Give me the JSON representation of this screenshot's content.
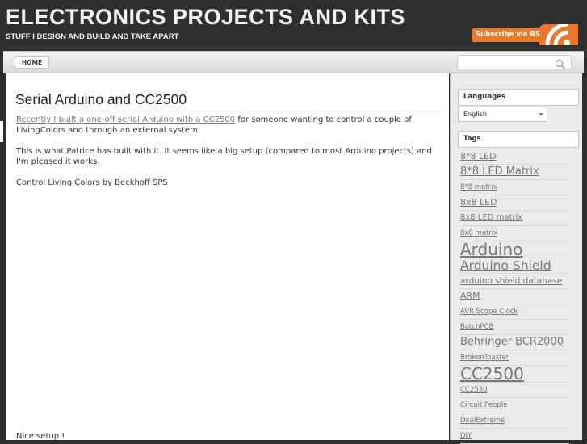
{
  "header": {
    "title": "ELECTRONICS PROJECTS AND KITS",
    "tagline": "STUFF I DESIGN AND BUILD AND TAKE APART",
    "rss_label": "Subscribe via RSS"
  },
  "nav": {
    "home_label": "HOME",
    "search_placeholder": ""
  },
  "post": {
    "title": "Serial Arduino and CC2500",
    "p1_link": "Recently I built a one-off serial Arduino with a CC2500",
    "p1_rest": " for someone wanting to control a couple of LivingColors and through an external system.",
    "p2": "This is what Patrice has built with it. It seems like a big setup (compared to most Arduino projects) and I'm pleased it works.",
    "p3": "Control Living Colors by Beckhoff SPS",
    "p4": "Nice setup !"
  },
  "sidebar": {
    "languages_title": "Languages",
    "language_selected": "English",
    "tags_title": "Tags",
    "tags": [
      {
        "label": "8*8 LED",
        "size": 11
      },
      {
        "label": "8*8 LED Matrix",
        "size": 13
      },
      {
        "label": "8*8 matrix",
        "size": 8.5
      },
      {
        "label": "8x8 LED",
        "size": 11
      },
      {
        "label": "8x8 LED matrix",
        "size": 10
      },
      {
        "label": "8x8 matrix",
        "size": 8.5
      },
      {
        "label": "Arduino",
        "size": 20
      },
      {
        "label": "Arduino Shield",
        "size": 15.5
      },
      {
        "label": "arduino shield database",
        "size": 10.5
      },
      {
        "label": "ARM",
        "size": 11
      },
      {
        "label": "AVR Scope Clock",
        "size": 8.5
      },
      {
        "label": "BatchPCB",
        "size": 8.5
      },
      {
        "label": "Behringer BCR2000",
        "size": 13
      },
      {
        "label": "BrokenToaster",
        "size": 8.5
      },
      {
        "label": "CC2500",
        "size": 20
      },
      {
        "label": "CC2530",
        "size": 8.5
      },
      {
        "label": "Circuit People",
        "size": 8.5
      },
      {
        "label": "DealExtreme",
        "size": 8.5
      },
      {
        "label": "DIY",
        "size": 8.5
      }
    ]
  },
  "colors": {
    "rss_orange": "#e9782a",
    "dark_bg": "#2e2e2e",
    "link": "#777777"
  }
}
